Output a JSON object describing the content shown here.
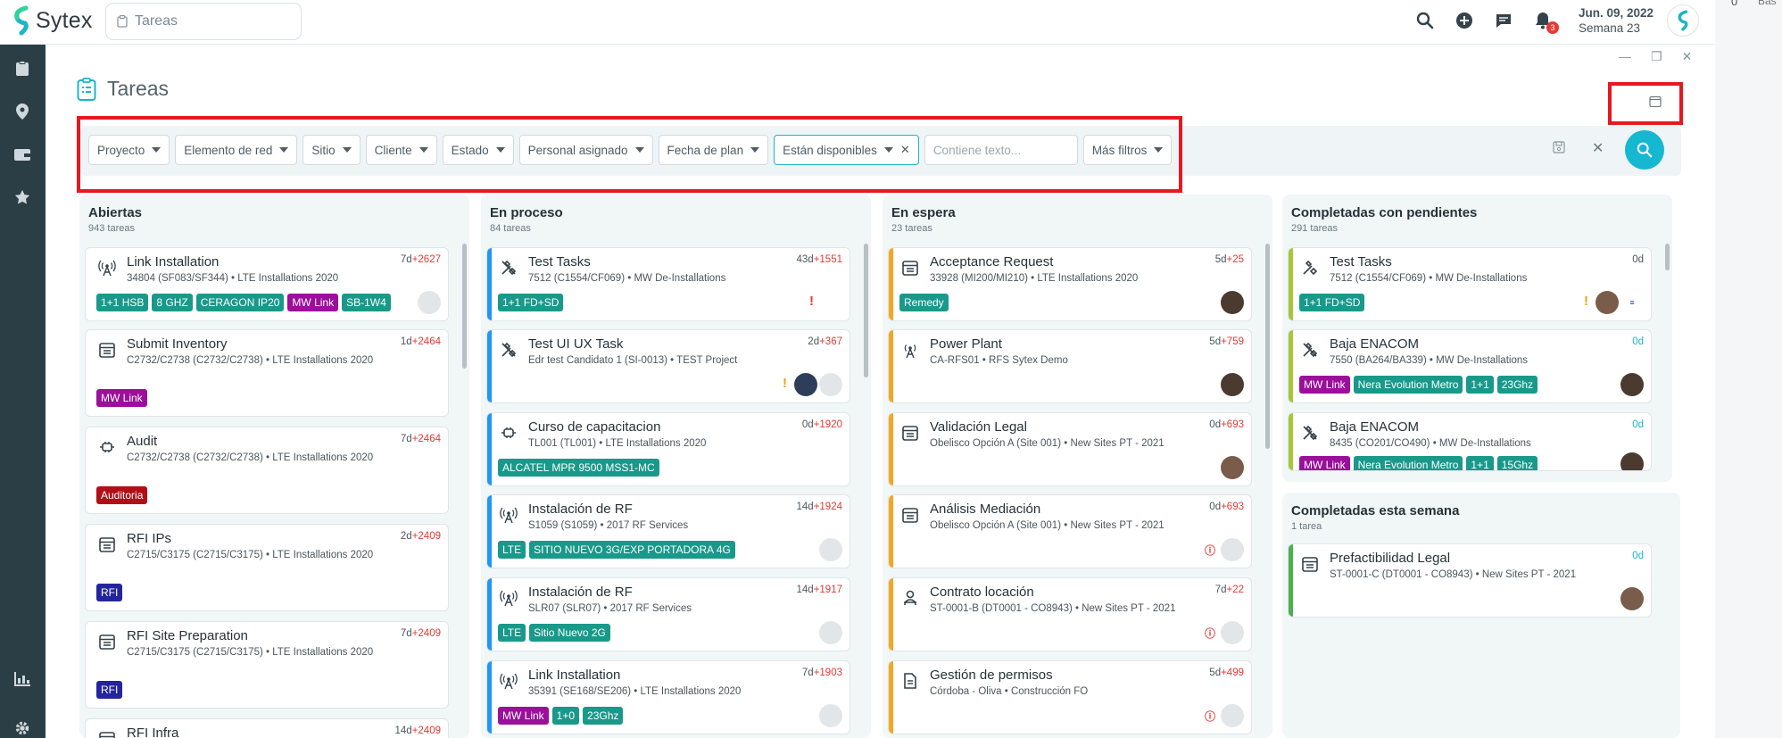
{
  "app": {
    "name": "Sytex",
    "search_placeholder": "Tareas"
  },
  "topbar": {
    "date": "Jun. 09, 2022",
    "week": "Semana 23",
    "notif_count": "3"
  },
  "right_strip": {
    "count": "0",
    "label": "Bas"
  },
  "page": {
    "title": "Tareas"
  },
  "filters": [
    {
      "label": "Proyecto"
    },
    {
      "label": "Elemento de red"
    },
    {
      "label": "Sitio"
    },
    {
      "label": "Cliente"
    },
    {
      "label": "Estado"
    },
    {
      "label": "Personal asignado"
    },
    {
      "label": "Fecha de plan"
    },
    {
      "label": "Están disponibles"
    }
  ],
  "filter_text_placeholder": "Contiene texto...",
  "more_filters": "Más filtros",
  "columns": [
    {
      "title": "Abiertas",
      "count": "943 tareas",
      "cards": [
        {
          "title": "Link Installation",
          "sub": "34804 (SF083/SF344)  •  LTE Installations 2020",
          "days": "7d",
          "delta": "+2627",
          "tags": [
            "1+1 HSB",
            "8 GHZ",
            "CERAGON IP20",
            "MW Link",
            "SB-1W4"
          ]
        },
        {
          "title": "Submit Inventory",
          "sub": "C2732/C2738 (C2732/C2738)  •  LTE Installations 2020",
          "days": "1d",
          "delta": "+2464",
          "tags": [
            "MW Link"
          ]
        },
        {
          "title": "Audit",
          "sub": "C2732/C2738 (C2732/C2738)  •  LTE Installations 2020",
          "days": "7d",
          "delta": "+2464",
          "tags": [
            "Auditoria"
          ]
        },
        {
          "title": "RFI IPs",
          "sub": "C2715/C3175 (C2715/C3175)  •  LTE Installations 2020",
          "days": "2d",
          "delta": "+2409",
          "tags": [
            "RFI"
          ]
        },
        {
          "title": "RFI Site Preparation",
          "sub": "C2715/C3175 (C2715/C3175)  •  LTE Installations 2020",
          "days": "7d",
          "delta": "+2409",
          "tags": [
            "RFI"
          ]
        },
        {
          "title": "RFI Infra",
          "sub": "",
          "days": "14d",
          "delta": "+2409",
          "tags": []
        }
      ]
    },
    {
      "title": "En proceso",
      "count": "84 tareas",
      "cards": [
        {
          "title": "Test Tasks",
          "sub": "7512 (C1554/CF069)  •  MW De-Installations",
          "days": "43d",
          "delta": "+1551",
          "tags": [
            "1+1 FD+SD"
          ]
        },
        {
          "title": "Test UI UX Task",
          "sub": "Edr test Candidato 1 (SI-0013)  •  TEST Project",
          "days": "2d",
          "delta": "+367",
          "tags": []
        },
        {
          "title": "Curso de capacitacion",
          "sub": "TL001 (TL001)  •  LTE Installations 2020",
          "days": "0d",
          "delta": "+1920",
          "tags": [
            "ALCATEL MPR 9500 MSS1-MC"
          ]
        },
        {
          "title": "Instalación de RF",
          "sub": "S1059 (S1059)  •  2017 RF Services",
          "days": "14d",
          "delta": "+1924",
          "tags": [
            "LTE",
            "SITIO NUEVO 3G/EXP PORTADORA 4G"
          ]
        },
        {
          "title": "Instalación de RF",
          "sub": "SLR07 (SLR07)  •  2017 RF Services",
          "days": "14d",
          "delta": "+1917",
          "tags": [
            "LTE",
            "Sitio Nuevo 2G"
          ]
        },
        {
          "title": "Link Installation",
          "sub": "35391 (SE168/SE206)  •  LTE Installations 2020",
          "days": "7d",
          "delta": "+1903",
          "tags": [
            "MW Link",
            "1+0",
            "23Ghz"
          ]
        }
      ]
    },
    {
      "title": "En espera",
      "count": "23 tareas",
      "cards": [
        {
          "title": "Acceptance Request",
          "sub": "33928 (MI200/MI210)  •  LTE Installations 2020",
          "days": "5d",
          "delta": "+25",
          "tags": [
            "Remedy"
          ]
        },
        {
          "title": "Power Plant",
          "sub": "CA-RFS01  •  RFS Sytex Demo",
          "days": "5d",
          "delta": "+759",
          "tags": []
        },
        {
          "title": "Validación Legal",
          "sub": "Obelisco Opción A (Site 001)  •  New Sites PT - 2021",
          "days": "0d",
          "delta": "+693",
          "tags": []
        },
        {
          "title": "Análisis Mediación",
          "sub": "Obelisco Opción A (Site 001)  •  New Sites PT - 2021",
          "days": "0d",
          "delta": "+693",
          "tags": []
        },
        {
          "title": "Contrato locación",
          "sub": "ST-0001-B (DT0001 - CO8943)  •  New Sites PT - 2021",
          "days": "7d",
          "delta": "+22",
          "tags": []
        },
        {
          "title": "Gestión de permisos",
          "sub": "Córdoba - Oliva  •  Construcción FO",
          "days": "5d",
          "delta": "+499",
          "tags": []
        }
      ]
    },
    {
      "title": "Completadas con pendientes",
      "count": "291 tareas",
      "cards": [
        {
          "title": "Test Tasks",
          "sub": "7512 (C1554/CF069)  •  MW De-Installations",
          "days": "0d",
          "delta": "",
          "tags": [
            "1+1 FD+SD"
          ]
        },
        {
          "title": "Baja ENACOM",
          "sub": "7550 (BA264/BA339)  •  MW De-Installations",
          "days": "0d",
          "delta": "",
          "tags": [
            "MW Link",
            "Nera Evolution Metro",
            "1+1",
            "23Ghz"
          ]
        },
        {
          "title": "Baja ENACOM",
          "sub": "8435 (CO201/CO490)  •  MW De-Installations",
          "days": "0d",
          "delta": "",
          "tags": [
            "MW Link",
            "Nera Evolution Metro",
            "1+1",
            "15Ghz"
          ]
        }
      ]
    },
    {
      "title": "Completadas esta semana",
      "count": "1 tarea",
      "cards": [
        {
          "title": "Prefactibilidad Legal",
          "sub": "ST-0001-C (DT0001 - CO8943)  •  New Sites PT - 2021",
          "days": "0d",
          "delta": "",
          "tags": []
        }
      ]
    }
  ]
}
